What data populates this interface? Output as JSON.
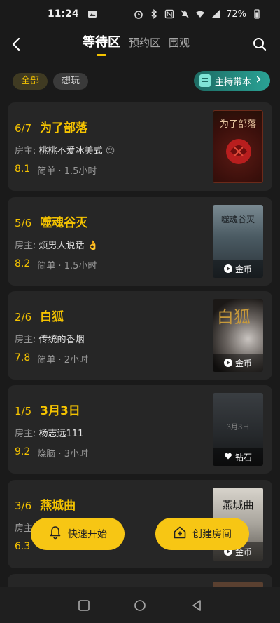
{
  "status": {
    "time": "11:24",
    "battery": "72%"
  },
  "header": {
    "tabs": [
      {
        "label": "等待区",
        "active": true
      },
      {
        "label": "预约区",
        "active": false
      },
      {
        "label": "围观",
        "active": false
      }
    ]
  },
  "filters": {
    "all": "全部",
    "want": "想玩",
    "host_button": "主持带本"
  },
  "host_prefix": "房主:",
  "cards": [
    {
      "count": "6/7",
      "name": "为了部落",
      "host": "桃桃不爱冰美式",
      "host_emoji": "😍",
      "score": "8.1",
      "difficulty": "简单",
      "duration": "1.5小时",
      "cover_title": "为了部落",
      "badge": ""
    },
    {
      "count": "5/6",
      "name": "噬魂谷灭",
      "host": "烦男人说话",
      "host_emoji": "👌",
      "score": "8.2",
      "difficulty": "简单",
      "duration": "1.5小时",
      "cover_title": "噬魂谷灭",
      "badge": "金币"
    },
    {
      "count": "2/6",
      "name": "白狐",
      "host": "传统的香烟",
      "host_emoji": "",
      "score": "7.8",
      "difficulty": "简单",
      "duration": "2小时",
      "cover_title": "白狐",
      "badge": "金币"
    },
    {
      "count": "1/5",
      "name": "3月3日",
      "host": "杨志远111",
      "host_emoji": "",
      "score": "9.2",
      "difficulty": "烧脑",
      "duration": "3小时",
      "cover_title": "3月3日",
      "badge": "钻石"
    },
    {
      "count": "3/6",
      "name": "燕城曲",
      "host": "",
      "host_emoji": "",
      "score": "6.3",
      "difficulty": "",
      "duration": "",
      "cover_title": "燕城曲",
      "badge": "金币"
    }
  ],
  "actions": {
    "quick_start": "快速开始",
    "create_room": "创建房间"
  },
  "colors": {
    "accent": "#f5c300",
    "background": "#1a1a1a",
    "card": "#262626",
    "teal": "#2aa295"
  },
  "icons": [
    "back-icon",
    "search-icon",
    "book-icon",
    "chevron-right-icon",
    "coin-icon",
    "heart-icon",
    "bell-icon",
    "home-plus-icon"
  ]
}
